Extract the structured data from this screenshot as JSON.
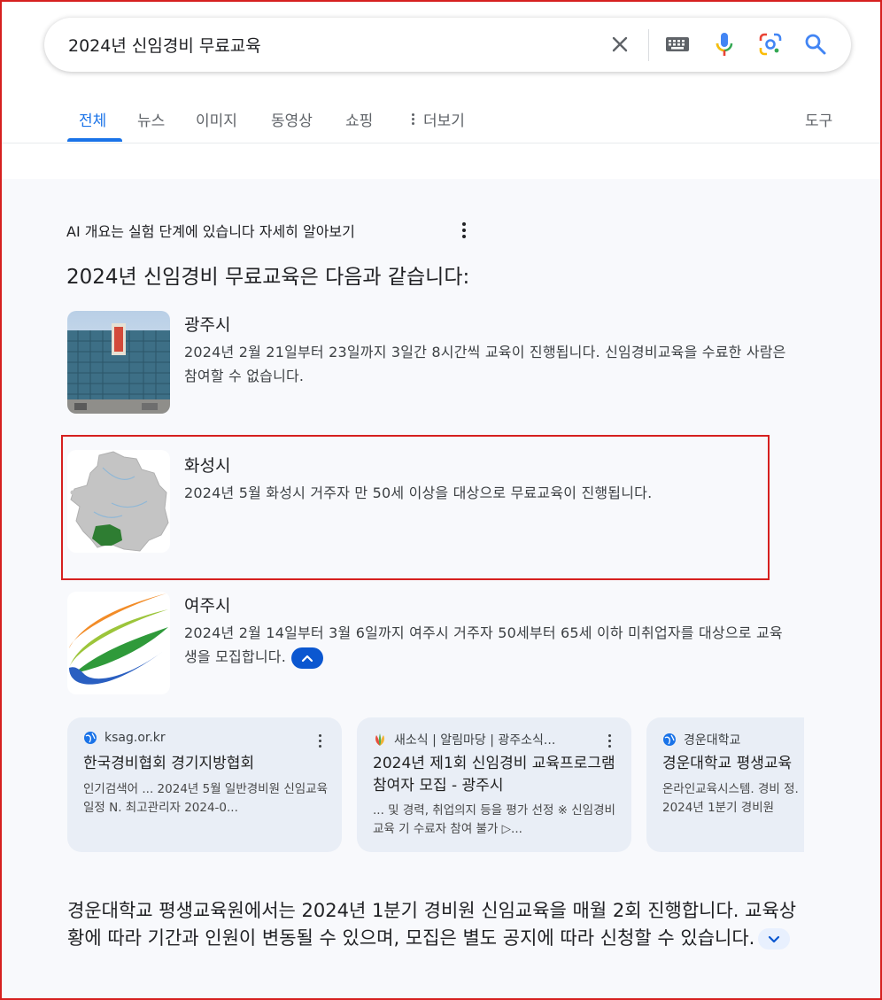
{
  "search": {
    "query": "2024년 신임경비 무료교육"
  },
  "tabs": [
    {
      "label": "전체",
      "active": true
    },
    {
      "label": "뉴스"
    },
    {
      "label": "이미지"
    },
    {
      "label": "동영상"
    },
    {
      "label": "쇼핑"
    },
    {
      "label": "더보기"
    }
  ],
  "tools_label": "도구",
  "ai_overview": {
    "header": "AI 개요는 실험 단계에 있습니다 자세히 알아보기",
    "headline": "2024년 신임경비 무료교육은 다음과 같습니다:",
    "items": [
      {
        "title": "광주시",
        "body": "2024년 2월 21일부터 23일까지 3일간 8시간씩 교육이 진행됩니다. 신임경비교육을 수료한 사람은 참여할 수 없습니다.",
        "thumbnail": "building-photo"
      },
      {
        "title": "화성시",
        "body": "2024년 5월 화성시 거주자 만 50세 이상을 대상으로 무료교육이 진행됩니다.",
        "thumbnail": "region-map"
      },
      {
        "title": "여주시",
        "body": "2024년 2월 14일부터 3월 6일까지 여주시 거주자 50세부터 65세 이하 미취업자를 대상으로 교육생을 모집합니다.",
        "thumbnail": "city-logo"
      }
    ]
  },
  "sources": [
    {
      "site": "ksag.or.kr",
      "title": "한국경비협회 경기지방협회",
      "snippet": "인기검색어 ... 2024년 5월 일반경비원 신임교육일정 N. 최고관리자 2024-0..."
    },
    {
      "site": "새소식 | 알림마당 | 광주소식...",
      "title": "2024년 제1회 신임경비 교육프로그램 참여자 모집 - 광주시",
      "snippet": "... 및 경력, 취업의지 등을 평가 선정 ※ 신임경비교육 기 수료자 참여 불가 ▷..."
    },
    {
      "site": "경운대학교",
      "title": "경운대학교 평생교육",
      "snippet": "온라인교육시스템. 경비 정. 2024년 1분기 경비원"
    }
  ],
  "summary": "경운대학교 평생교육원에서는 2024년 1분기 경비원 신임교육을 매월 2회 진행합니다. 교육상황에 따라 기간과 인원이 변동될 수 있으며, 모집은 별도 공지에 따라 신청할 수 있습니다.",
  "colors": {
    "accent": "#1a73e8",
    "highlight": "#d6201f",
    "panel": "#f8f9fc",
    "card": "#e9eef6"
  },
  "icons": {
    "clear": "close-icon",
    "keyboard": "keyboard-icon",
    "voice": "microphone-icon",
    "lens": "lens-icon",
    "search": "search-icon"
  }
}
